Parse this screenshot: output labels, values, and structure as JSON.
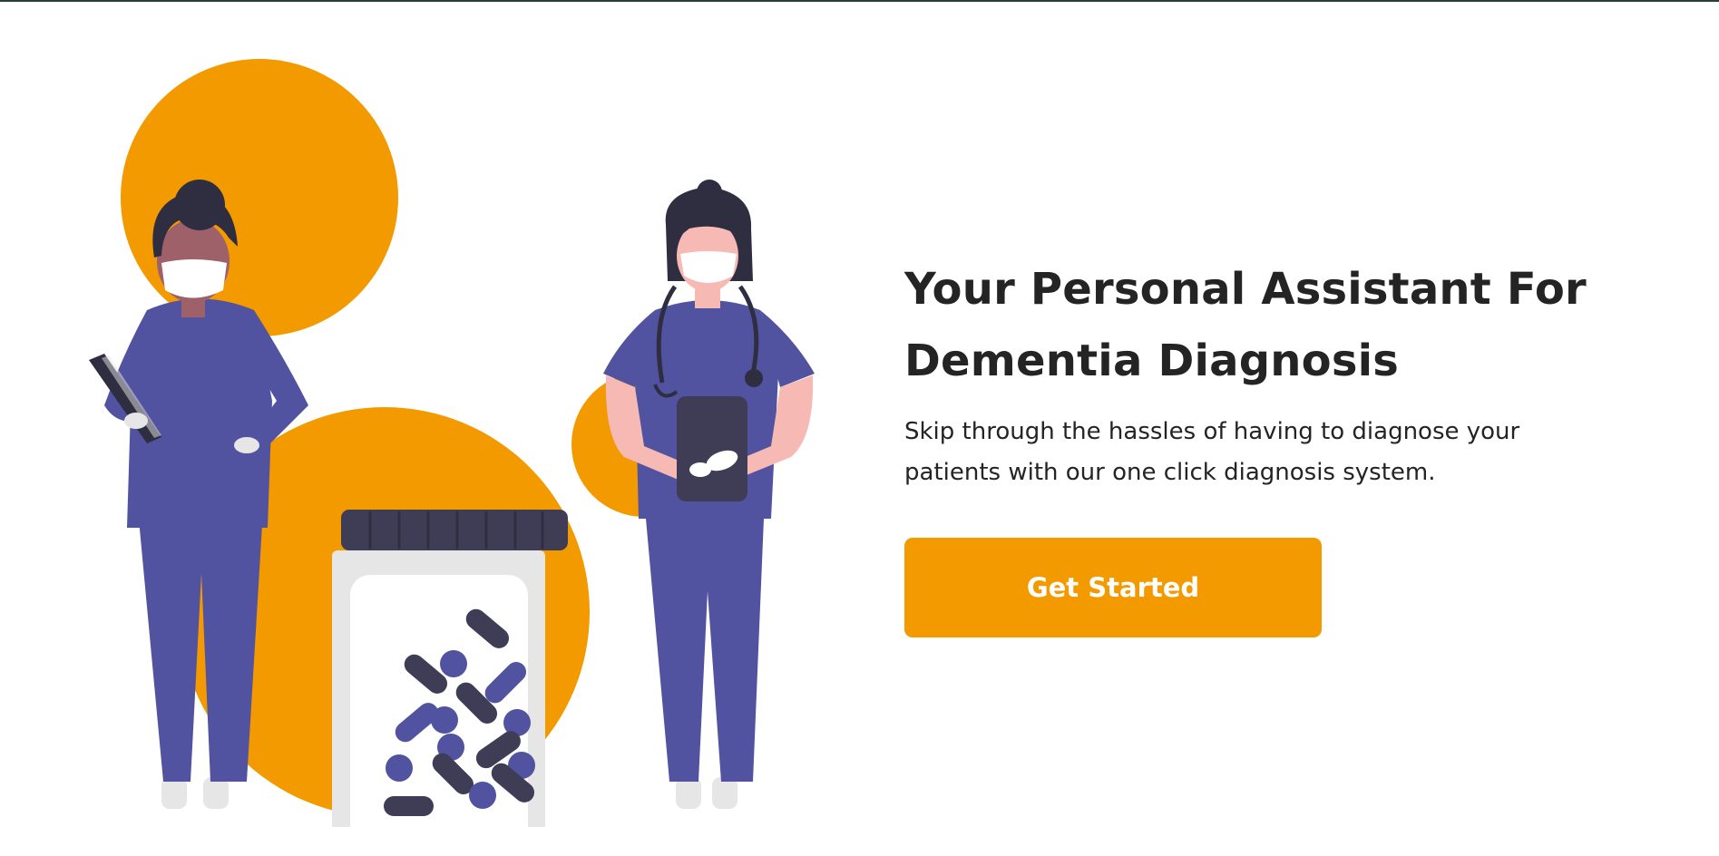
{
  "hero": {
    "title": "Your Personal Assistant For Dementia Diagnosis",
    "subtitle": "Skip through the hassles of having to diagnose your patients with our one click diagnosis system.",
    "cta_label": "Get Started"
  },
  "illustration": {
    "description_icon": "doctors-with-pill-jar-illustration"
  },
  "colors": {
    "accent": "#f29a00",
    "scrubs": "#5253a0",
    "dark": "#2f2e41",
    "text": "#242424",
    "jar": "#e6e6e6",
    "skin_light": "#f6b9b4",
    "skin_dark": "#9e616a"
  }
}
